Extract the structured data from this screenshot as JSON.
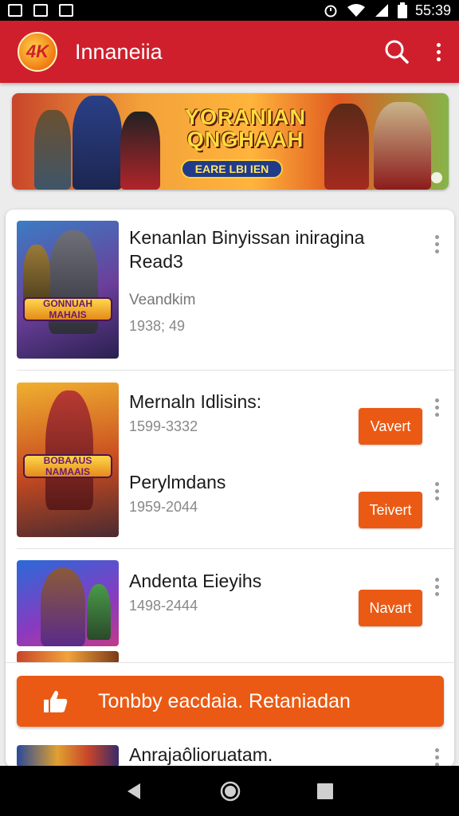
{
  "status_bar": {
    "time": "55:39"
  },
  "app_bar": {
    "logo_text": "4K",
    "title": "Innaneiia"
  },
  "banner": {
    "title": "YORANIAN QNGHAAH",
    "cta": "EARE LBI IEN"
  },
  "items": [
    {
      "title": "Kenanlan Binyissan iniragina Read3",
      "subtitle": "Veandkim",
      "meta": "1938; 49",
      "thumb_text": "GONNUAH MAHAIS"
    },
    {
      "title": "Mernaln Idlisins:",
      "meta": "1599-3332",
      "button": "Vavert",
      "thumb_text": "BOBAAUS NAMAAIS"
    },
    {
      "title": "Perylmdans",
      "meta": "1959-2044",
      "button": "Teivert"
    },
    {
      "title": "Andenta Eieyihs",
      "meta": "1498-2444",
      "button": "Navart"
    },
    {
      "title": "Anrajaôlioruatam."
    }
  ],
  "main_action": {
    "label": "Tonbby eacdaia. Retaniadan"
  },
  "colors": {
    "app_bar": "#d01f2c",
    "accent": "#ea5a14"
  }
}
